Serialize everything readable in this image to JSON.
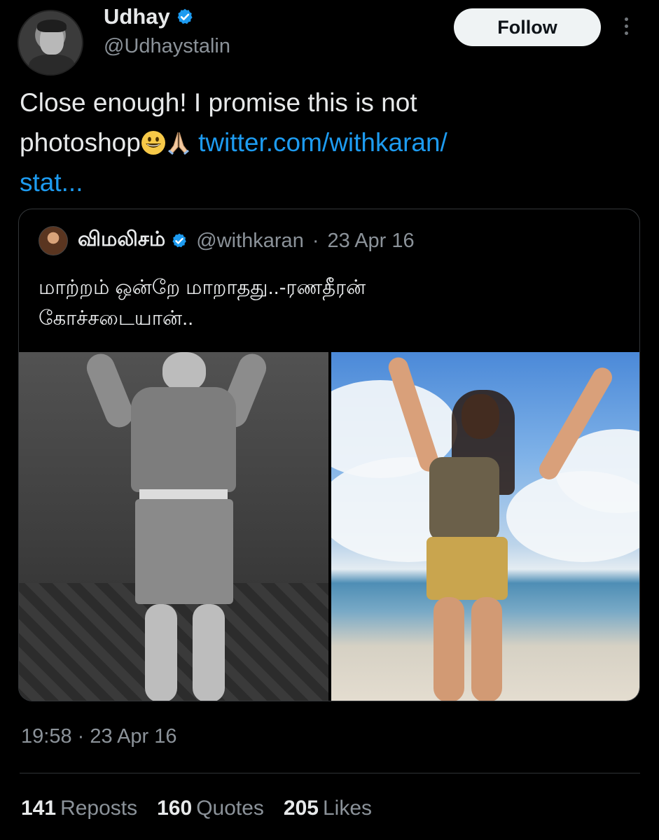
{
  "author": {
    "name": "Udhay",
    "handle": "@Udhaystalin",
    "follow_label": "Follow"
  },
  "tweet": {
    "text_line1": "Close enough! I promise this is not",
    "text_line2": "photoshop",
    "emoji_1": "grinning-face",
    "emoji_2": "folded-hands",
    "link_part1": "twitter.com/withkaran/",
    "link_part2": "stat..."
  },
  "quote": {
    "name": "விமலிசம்",
    "handle": "@withkaran",
    "date": "23 Apr 16",
    "separator": "·",
    "text_line1": "மாற்றம் ஒன்றே மாறாதது..-ரணதீரன்",
    "text_line2": "கோச்சடையான்.."
  },
  "timestamp": {
    "time": "19:58",
    "date": "23 Apr 16",
    "separator": "·"
  },
  "stats": [
    {
      "count": "141",
      "label": "Reposts"
    },
    {
      "count": "160",
      "label": "Quotes"
    },
    {
      "count": "205",
      "label": "Likes"
    }
  ],
  "colors": {
    "background": "#000000",
    "text": "#e7e9ea",
    "muted": "#8b9299",
    "link": "#1d9bf0",
    "verified": "#1d9bf0"
  }
}
